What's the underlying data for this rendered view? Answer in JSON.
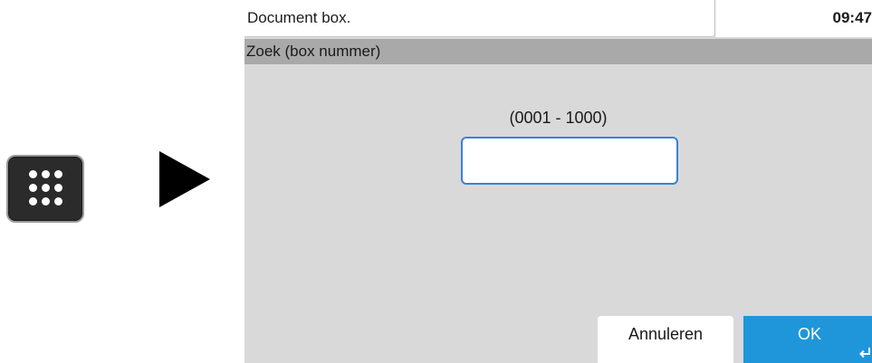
{
  "header": {
    "title": "Document box.",
    "time": "09:47"
  },
  "subheader": {
    "title": "Zoek (box nummer)"
  },
  "prompt": {
    "range": "(0001 - 1000)"
  },
  "input": {
    "value": ""
  },
  "buttons": {
    "cancel": "Annuleren",
    "ok": "OK"
  },
  "icons": {
    "keypad_key": "keypad-grid-icon",
    "arrow": "arrow-right-icon",
    "enter": "enter-return-icon"
  },
  "colors": {
    "accent": "#1e96d9",
    "input_border": "#3a82d6",
    "panel_bg": "#d9d9d9",
    "subheader_bg": "#a9a9a9"
  }
}
